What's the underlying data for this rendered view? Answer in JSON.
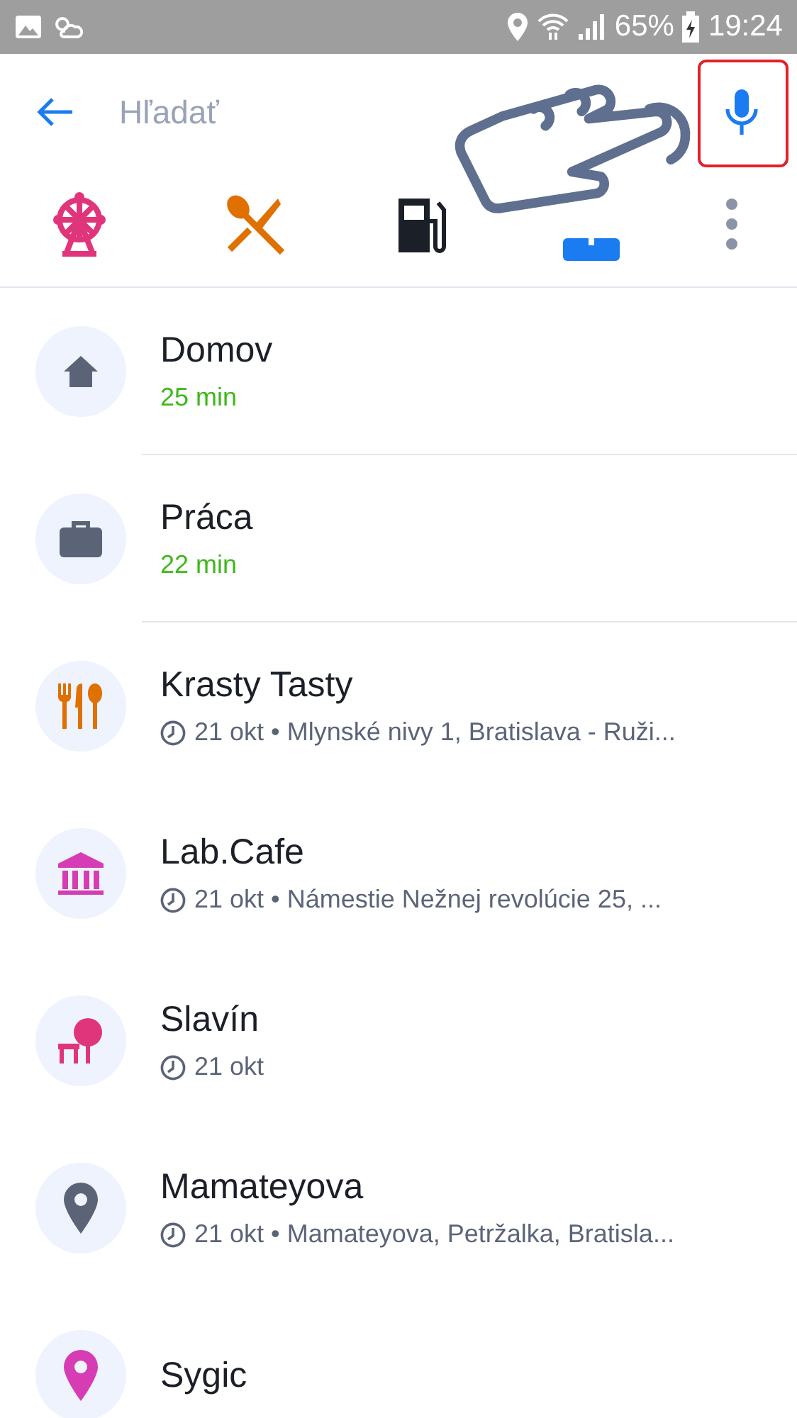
{
  "status_bar": {
    "battery": "65%",
    "time": "19:24"
  },
  "search": {
    "placeholder": "Hľadať"
  },
  "places": [
    {
      "kind": "saved",
      "color": "#5b6477",
      "title": "Domov",
      "eta": "25 min"
    },
    {
      "kind": "saved",
      "color": "#5b6477",
      "title": "Práca",
      "eta": "22 min"
    },
    {
      "kind": "recent",
      "color": "#e07000",
      "title": "Krasty Tasty",
      "detail": "21 okt • Mlynské nivy 1, Bratislava - Ruži..."
    },
    {
      "kind": "recent",
      "color": "#d63cb4",
      "title": "Lab.Cafe",
      "detail": "21 okt • Námestie Nežnej revolúcie 25, ..."
    },
    {
      "kind": "recent",
      "color": "#e0357a",
      "title": "Slavín",
      "detail": "21 okt"
    },
    {
      "kind": "recent",
      "color": "#5b6477",
      "title": "Mamateyova",
      "detail": "21 okt • Mamateyova, Petržalka, Bratisla..."
    },
    {
      "kind": "recent",
      "color": "#d63cb4",
      "title": "Sygic"
    }
  ]
}
